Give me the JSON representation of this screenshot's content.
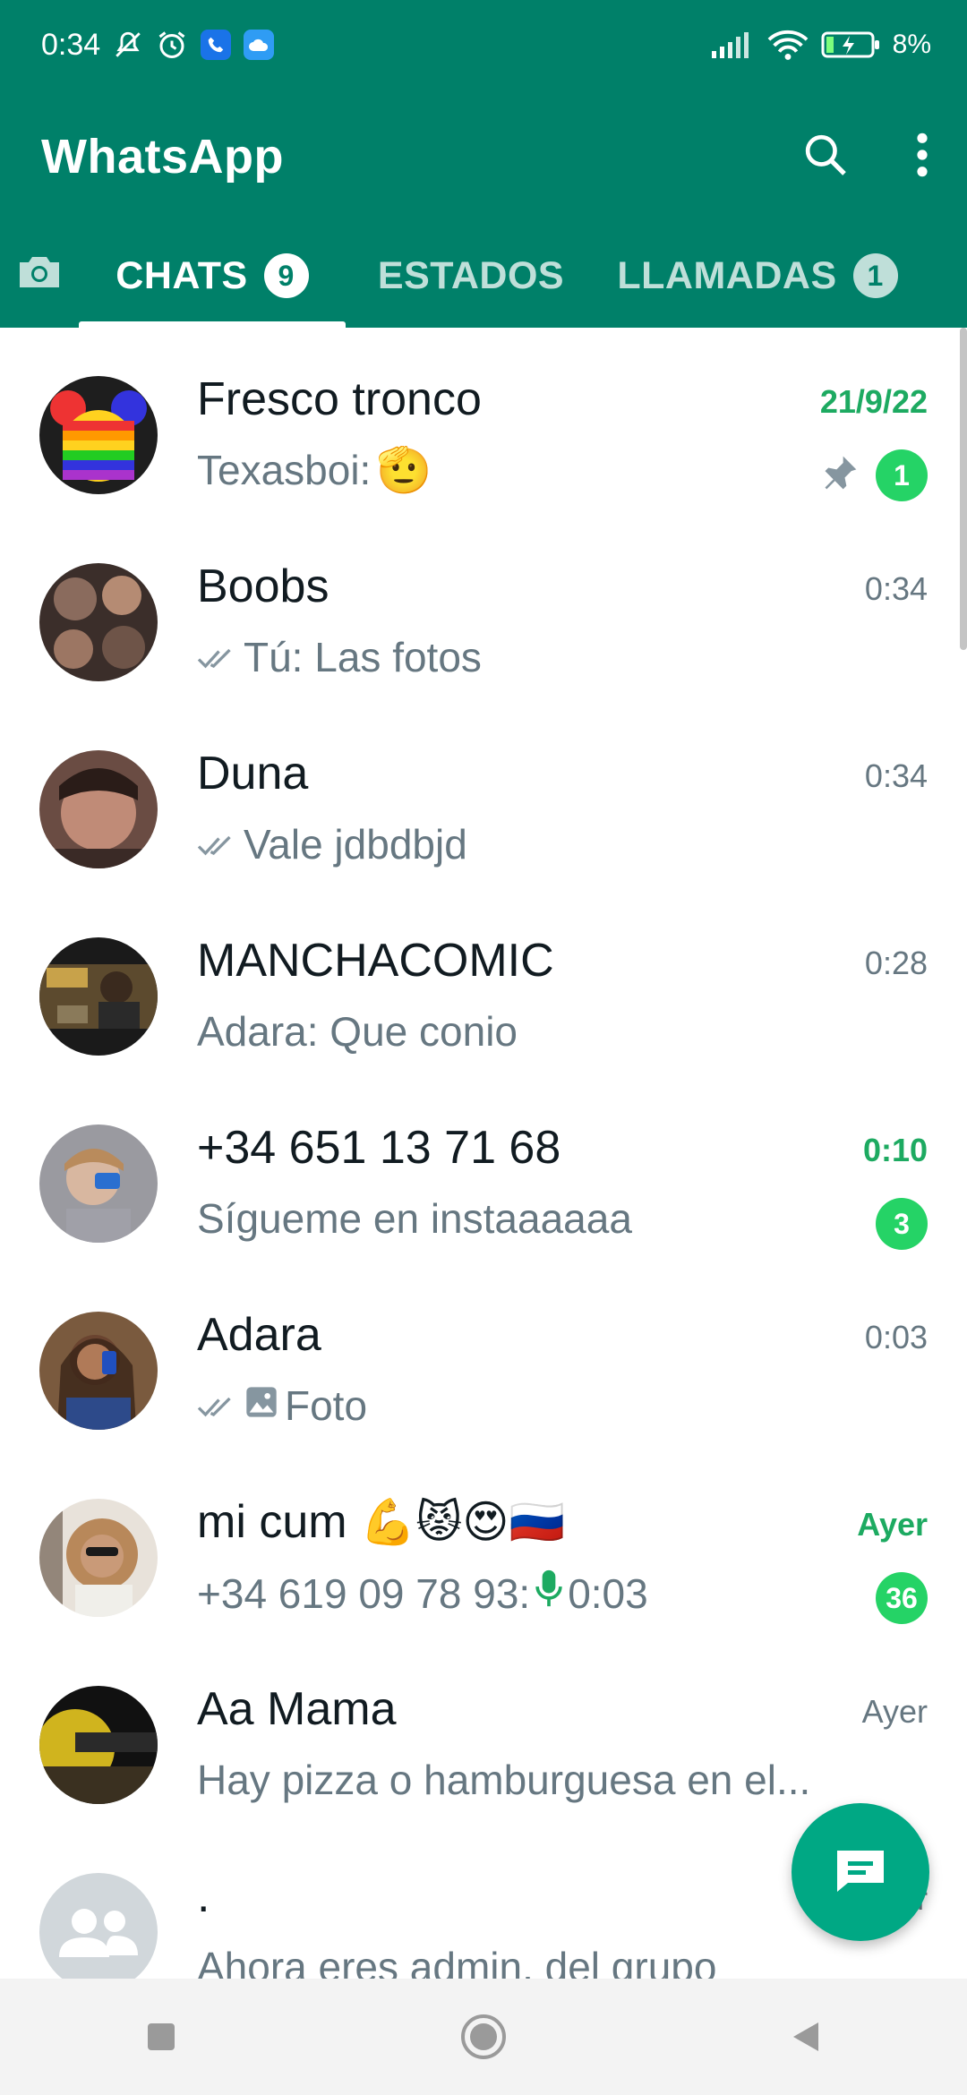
{
  "status_bar": {
    "time": "0:34",
    "battery": "8%",
    "icons": [
      "mute-icon",
      "alarm-icon",
      "phone-app-icon",
      "cloud-app-icon",
      "signal-icon",
      "wifi-icon",
      "battery-charging-icon"
    ]
  },
  "header": {
    "title": "WhatsApp",
    "actions": [
      "search-icon",
      "more-options-icon"
    ]
  },
  "tabs": [
    {
      "label": "",
      "icon": "camera-icon"
    },
    {
      "label": "CHATS",
      "badge": "9",
      "active": true
    },
    {
      "label": "ESTADOS"
    },
    {
      "label": "LLAMADAS",
      "badge": "1"
    }
  ],
  "chats": [
    {
      "name": "Fresco tronco",
      "preview_text": "Texasboi: ",
      "preview_emoji": "🫡",
      "time": "21/9/22",
      "unread": "1",
      "pinned": true
    },
    {
      "name": "Boobs",
      "preview_text": "Tú: Las fotos",
      "time": "0:34",
      "ticks": true
    },
    {
      "name": "Duna",
      "preview_text": "Vale jdbdbjd",
      "time": "0:34",
      "ticks": true
    },
    {
      "name": "MANCHACOMIC",
      "preview_text": "Adara: Que conio",
      "time": "0:28"
    },
    {
      "name": "+34 651 13 71 68",
      "preview_text": "Sígueme en instaaaaaa",
      "time": "0:10",
      "unread": "3"
    },
    {
      "name": "Adara",
      "preview_text": "Foto",
      "time": "0:03",
      "ticks": true,
      "photo_icon": true
    },
    {
      "name": "mi cum ",
      "name_emoji": "💪😾😍🇷🇺",
      "preview_text": "+34 619 09 78 93: ",
      "preview_audio": "0:03",
      "time": "Ayer",
      "unread": "36"
    },
    {
      "name": "Aa Mama",
      "preview_text": "Hay pizza o hamburguesa en el...",
      "time": "Ayer"
    },
    {
      "name": ".",
      "preview_text": "Ahora eres admin. del grupo",
      "time": "r"
    }
  ],
  "colors": {
    "brand": "#008069",
    "accent": "#25d366",
    "fab": "#00a884",
    "muted_text": "#667781"
  },
  "fab": {
    "icon": "new-chat-icon"
  },
  "nav": [
    "recents-button",
    "home-button",
    "back-button"
  ]
}
